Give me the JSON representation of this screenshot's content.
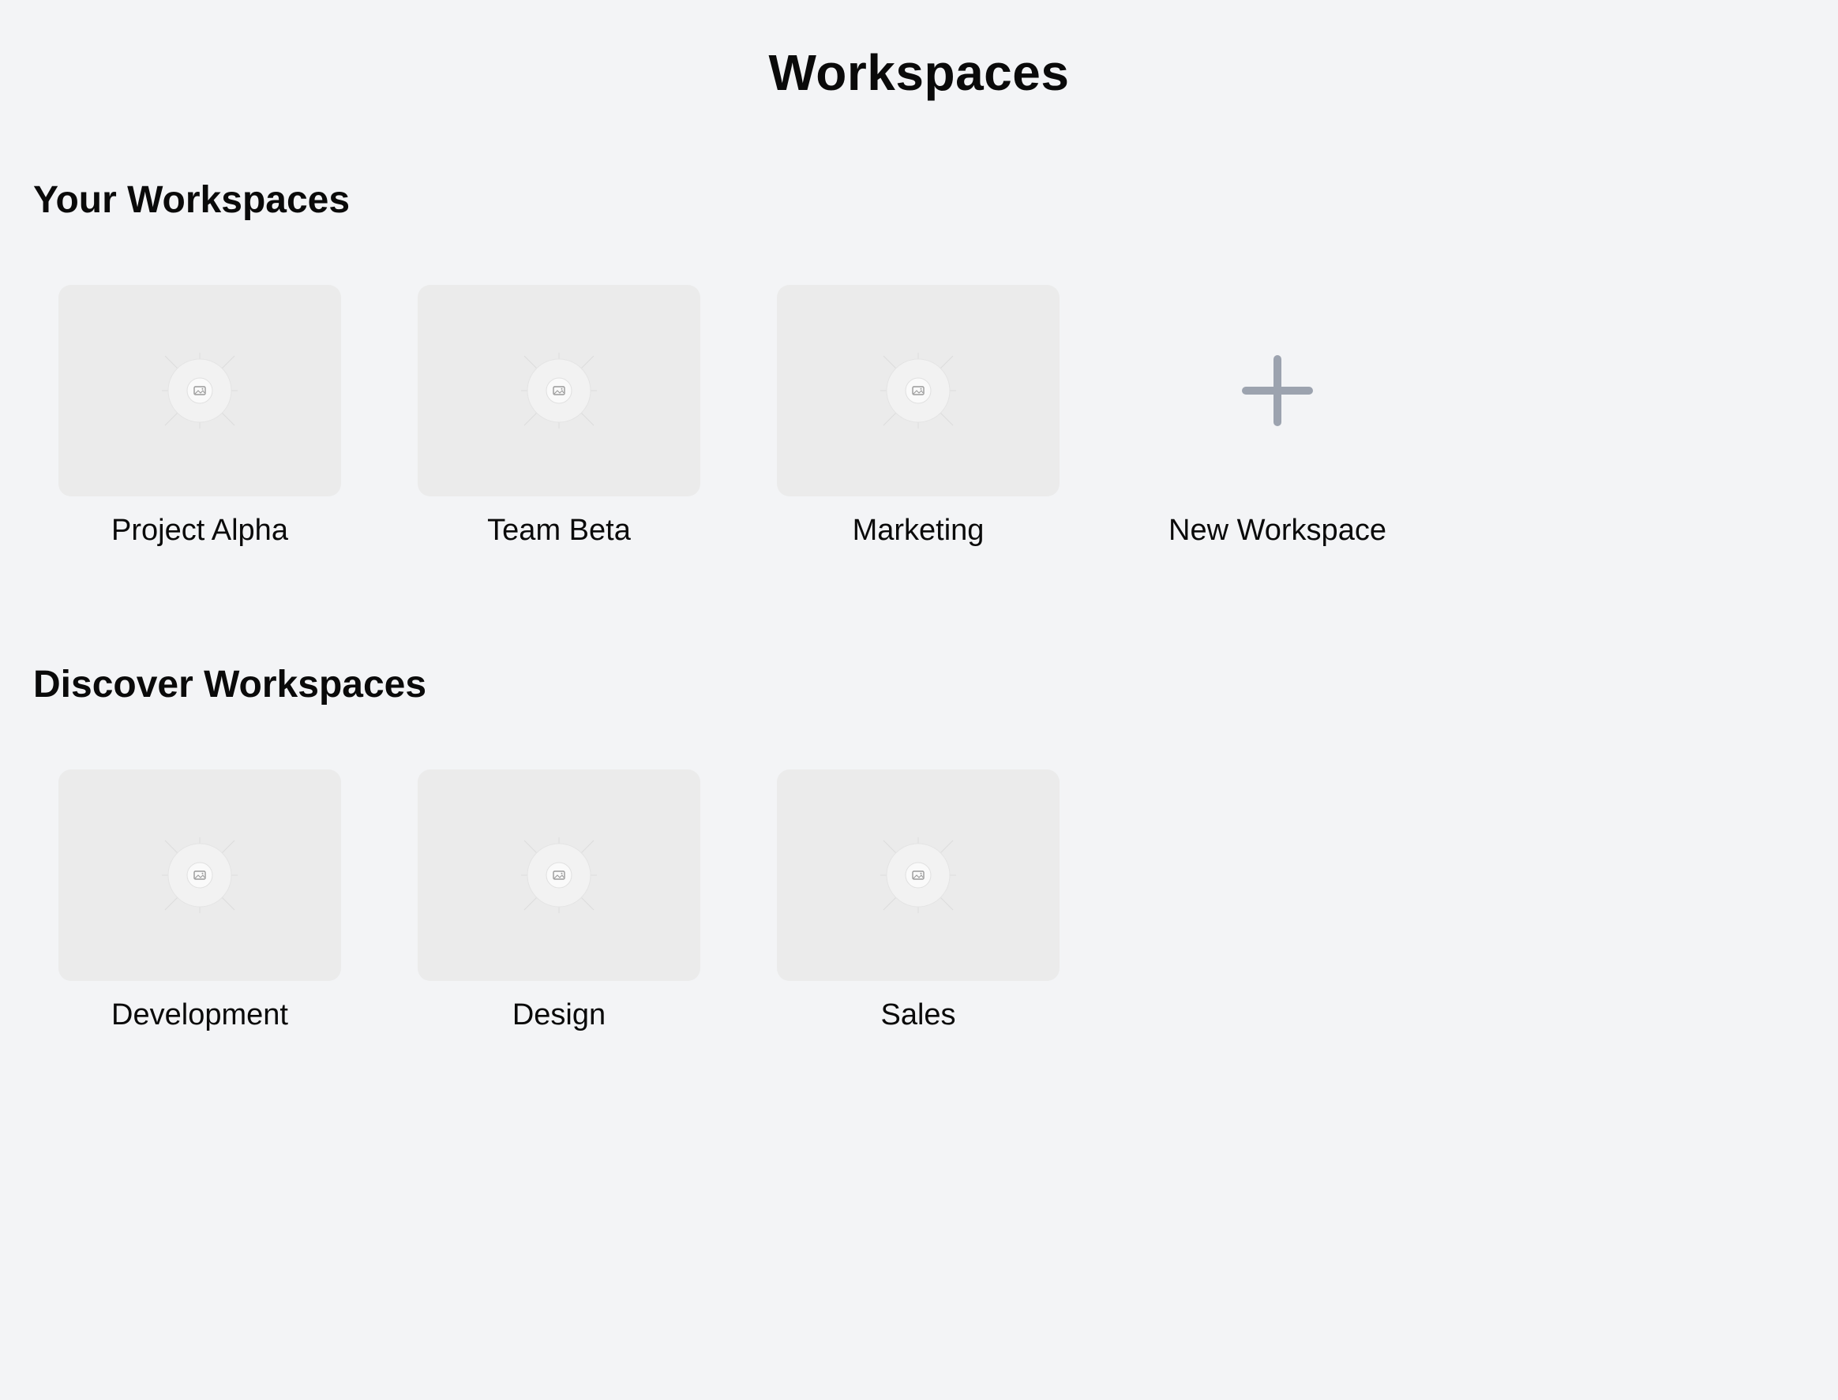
{
  "page": {
    "title": "Workspaces"
  },
  "your_workspaces": {
    "heading": "Your Workspaces",
    "items": [
      {
        "label": "Project Alpha",
        "icon": "image-placeholder-icon"
      },
      {
        "label": "Team Beta",
        "icon": "image-placeholder-icon"
      },
      {
        "label": "Marketing",
        "icon": "image-placeholder-icon"
      }
    ],
    "new_workspace": {
      "label": "New Workspace",
      "icon": "plus-icon"
    }
  },
  "discover_workspaces": {
    "heading": "Discover Workspaces",
    "items": [
      {
        "label": "Development",
        "icon": "image-placeholder-icon"
      },
      {
        "label": "Design",
        "icon": "image-placeholder-icon"
      },
      {
        "label": "Sales",
        "icon": "image-placeholder-icon"
      }
    ]
  },
  "colors": {
    "background": "#f3f4f6",
    "thumbnail": "#ebebeb",
    "plus_icon": "#9ca3af",
    "text": "#0a0a0a"
  }
}
